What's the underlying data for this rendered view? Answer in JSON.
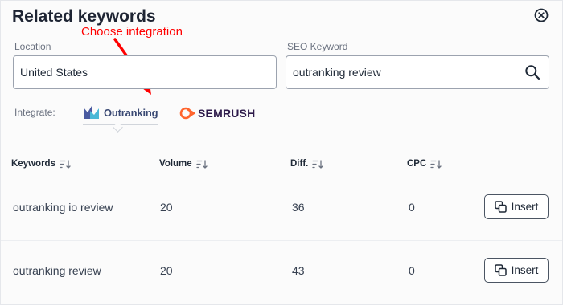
{
  "dialog": {
    "title": "Related keywords"
  },
  "annotation": {
    "text": "Choose integration",
    "color": "#ff0000"
  },
  "location": {
    "label": "Location",
    "value": "United States"
  },
  "seo_keyword": {
    "label": "SEO Keyword",
    "value": "outranking review"
  },
  "integrate": {
    "label": "Integrate:",
    "options": [
      {
        "name": "Outranking",
        "selected": true
      },
      {
        "name": "SEMRUSH",
        "selected": false
      }
    ]
  },
  "table": {
    "columns": [
      "Keywords",
      "Volume",
      "Diff.",
      "CPC"
    ],
    "rows": [
      {
        "keyword": "outranking io review",
        "volume": "20",
        "diff": "36",
        "cpc": "0",
        "action": "Insert"
      },
      {
        "keyword": "outranking review",
        "volume": "20",
        "diff": "43",
        "cpc": "0",
        "action": "Insert"
      }
    ]
  },
  "icons": {
    "close": "close-circle-icon",
    "search": "search-icon",
    "sort": "sort-icon",
    "insert": "copy-icon"
  },
  "colors": {
    "semrush_accent": "#ff642d",
    "outranking_navy": "#3b4a74"
  }
}
